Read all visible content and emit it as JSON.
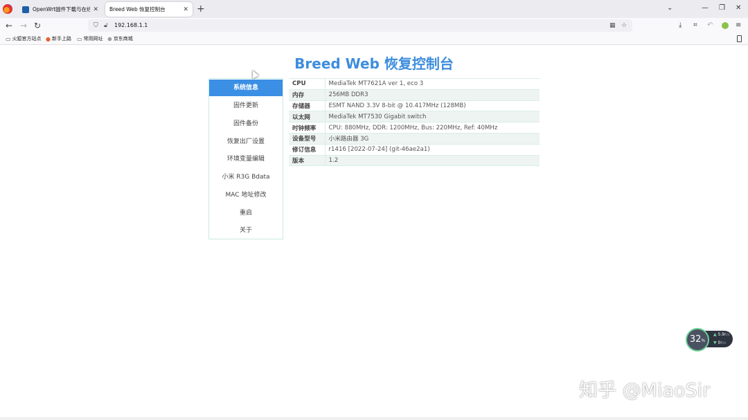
{
  "browser": {
    "tabs": [
      {
        "title": "OpenWrt固件下载与在线定制",
        "active": false
      },
      {
        "title": "Breed Web 恢复控制台",
        "active": true
      }
    ],
    "url": "192.168.1.1",
    "bookmarks": [
      {
        "label": "火狐官方站点",
        "icon": "folder-icon"
      },
      {
        "label": "新手上路",
        "icon": "firefox-icon"
      },
      {
        "label": "常用网址",
        "icon": "folder-icon"
      },
      {
        "label": "京东商城",
        "icon": "globe-icon"
      }
    ]
  },
  "page": {
    "title": "Breed Web 恢复控制台",
    "menu": [
      {
        "label": "系统信息",
        "active": true
      },
      {
        "label": "固件更新"
      },
      {
        "label": "固件备份"
      },
      {
        "label": "恢复出厂设置"
      },
      {
        "label": "环境变量编辑"
      },
      {
        "label": "小米 R3G Bdata"
      },
      {
        "label": "MAC 地址修改"
      },
      {
        "label": "重启"
      },
      {
        "label": "关于"
      }
    ],
    "info": [
      {
        "key": "CPU",
        "value": "MediaTek MT7621A ver 1, eco 3"
      },
      {
        "key": "内存",
        "value": "256MB DDR3"
      },
      {
        "key": "存储器",
        "value": "ESMT NAND 3.3V 8-bit @ 10.417MHz (128MB)"
      },
      {
        "key": "以太网",
        "value": "MediaTek MT7530 Gigabit switch"
      },
      {
        "key": "时钟频率",
        "value": "CPU: 880MHz, DDR: 1200MHz, Bus: 220MHz, Ref: 40MHz"
      },
      {
        "key": "设备型号",
        "value": "小米路由器 3G"
      },
      {
        "key": "修订信息",
        "value": "r1416 [2022-07-24] (git-46ae2a1)"
      },
      {
        "key": "版本",
        "value": "1.2"
      }
    ]
  },
  "widget": {
    "percent": "32",
    "percent_unit": "%",
    "up": "5.9",
    "up_unit": "K/s",
    "down": "0",
    "down_unit": "K/s"
  },
  "watermark": "知乎 @MiaoSir",
  "colors": {
    "title": "#3e8ddd",
    "menu_active": "#3b8fe4",
    "table_stripe": "#eef4f1",
    "border": "#c8ebe4"
  }
}
